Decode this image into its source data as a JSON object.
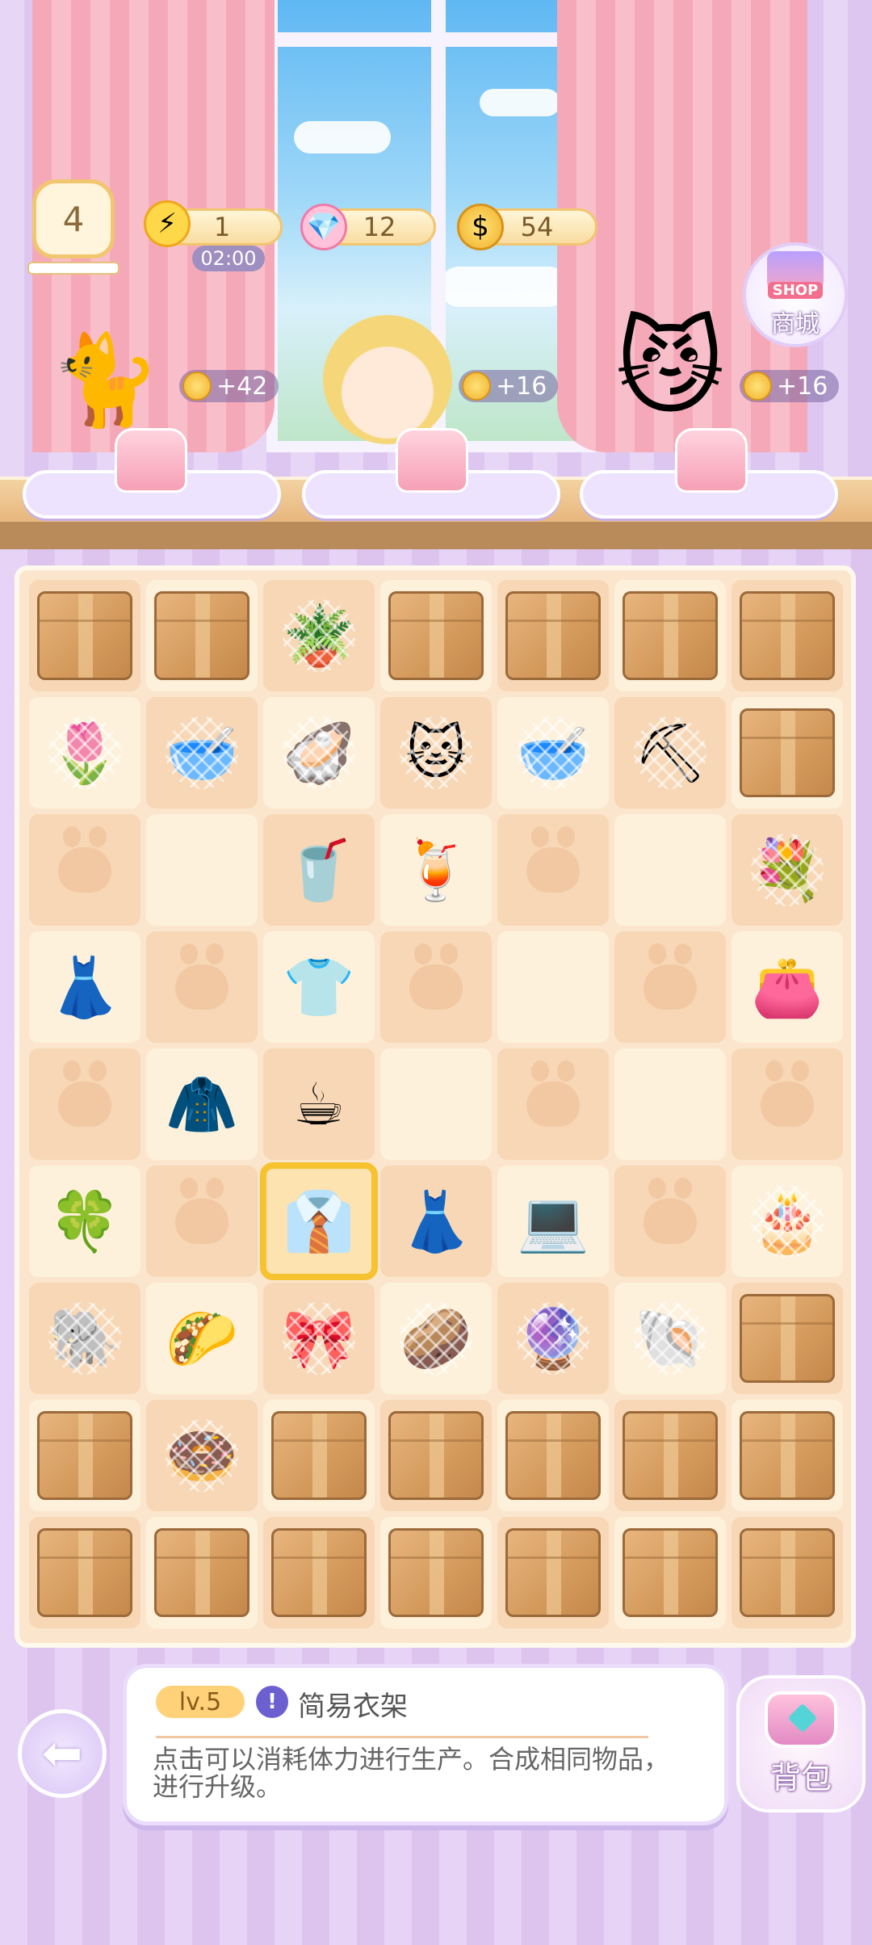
{
  "hud": {
    "level": "4",
    "energy": "1",
    "energy_timer": "02:00",
    "gems": "12",
    "coins": "54",
    "shop_tag": "SHOP",
    "shop_label": "商城"
  },
  "customers": [
    {
      "name": "white-cat-customer",
      "icon": "white-cat-icon",
      "reward": "+42",
      "order": "pink-kimono-icon"
    },
    {
      "name": "blond-boy-customer",
      "icon": "blond-boy-icon",
      "reward": "+16",
      "order": "pink-dress-icon"
    },
    {
      "name": "sunglasses-cat-customer",
      "icon": "sunglasses-cat-icon",
      "reward": "+16",
      "order": "pink-dress-icon"
    }
  ],
  "board": {
    "rows": [
      [
        {
          "k": "box"
        },
        {
          "k": "box"
        },
        {
          "k": "item",
          "g": "🪴",
          "n": "watering-can-icon",
          "w": true
        },
        {
          "k": "box"
        },
        {
          "k": "box"
        },
        {
          "k": "box"
        },
        {
          "k": "box"
        }
      ],
      [
        {
          "k": "item",
          "g": "🌷",
          "n": "tulip-icon",
          "w": true
        },
        {
          "k": "item",
          "g": "🥣",
          "n": "pet-bowl-icon",
          "w": true
        },
        {
          "k": "item",
          "g": "🦪",
          "n": "pearl-shell-icon",
          "w": true
        },
        {
          "k": "item",
          "g": "🐱",
          "n": "grey-cat-icon",
          "w": true
        },
        {
          "k": "item",
          "g": "🥣",
          "n": "teal-bowl-icon",
          "w": true
        },
        {
          "k": "item",
          "g": "⛏",
          "n": "shovel-icon",
          "w": true
        },
        {
          "k": "box"
        }
      ],
      [
        {
          "k": "paw"
        },
        {
          "k": "empty"
        },
        {
          "k": "item",
          "g": "🥤",
          "n": "cola-drink-icon"
        },
        {
          "k": "item",
          "g": "🍹",
          "n": "strawberry-drink-icon"
        },
        {
          "k": "paw"
        },
        {
          "k": "empty"
        },
        {
          "k": "item",
          "g": "💐",
          "n": "flower-bouquet-icon",
          "w": true
        }
      ],
      [
        {
          "k": "item",
          "g": "👗",
          "n": "maid-dress-icon"
        },
        {
          "k": "paw"
        },
        {
          "k": "item",
          "g": "👕",
          "n": "green-sweater-icon"
        },
        {
          "k": "paw"
        },
        {
          "k": "empty"
        },
        {
          "k": "paw"
        },
        {
          "k": "item",
          "g": "👛",
          "n": "pink-purse-icon"
        }
      ],
      [
        {
          "k": "paw"
        },
        {
          "k": "item",
          "g": "🧥",
          "n": "lilac-coat-icon"
        },
        {
          "k": "item",
          "g": "☕",
          "n": "tea-cup-icon"
        },
        {
          "k": "empty"
        },
        {
          "k": "paw"
        },
        {
          "k": "empty"
        },
        {
          "k": "paw"
        }
      ],
      [
        {
          "k": "item",
          "g": "🍀",
          "n": "green-clover-icon"
        },
        {
          "k": "paw"
        },
        {
          "k": "item",
          "g": "👔",
          "n": "clothes-rack-icon",
          "sel": true
        },
        {
          "k": "item",
          "g": "👗",
          "n": "white-dress-icon"
        },
        {
          "k": "item",
          "g": "💻",
          "n": "computer-icon"
        },
        {
          "k": "paw"
        },
        {
          "k": "item",
          "g": "🎂",
          "n": "fruit-cake-icon",
          "w": true
        }
      ],
      [
        {
          "k": "item",
          "g": "🐘",
          "n": "grey-plush-icon",
          "w": true
        },
        {
          "k": "item",
          "g": "🌮",
          "n": "cat-taco-icon"
        },
        {
          "k": "item",
          "g": "🎀",
          "n": "scrunchie-icon",
          "w": true
        },
        {
          "k": "item",
          "g": "🥔",
          "n": "brown-egg-icon",
          "w": true
        },
        {
          "k": "item",
          "g": "🔮",
          "n": "purple-egg-icon",
          "w": true
        },
        {
          "k": "item",
          "g": "🐚",
          "n": "snail-shell-icon",
          "w": true
        },
        {
          "k": "box"
        }
      ],
      [
        {
          "k": "box"
        },
        {
          "k": "item",
          "g": "🍩",
          "n": "bread-ring-icon",
          "w": true
        },
        {
          "k": "box"
        },
        {
          "k": "box"
        },
        {
          "k": "box"
        },
        {
          "k": "box"
        },
        {
          "k": "box"
        }
      ],
      [
        {
          "k": "box"
        },
        {
          "k": "box"
        },
        {
          "k": "box"
        },
        {
          "k": "box"
        },
        {
          "k": "box"
        },
        {
          "k": "box"
        },
        {
          "k": "box"
        }
      ]
    ]
  },
  "info": {
    "level": "lv.5",
    "name": "简易衣架",
    "description": "点击可以消耗体力进行生产。合成相同物品，进行升级。"
  },
  "bag_label": "背包",
  "colors": {
    "accent": "#f6c230",
    "panel": "#eadcfb",
    "board": "#fbe6cd"
  }
}
